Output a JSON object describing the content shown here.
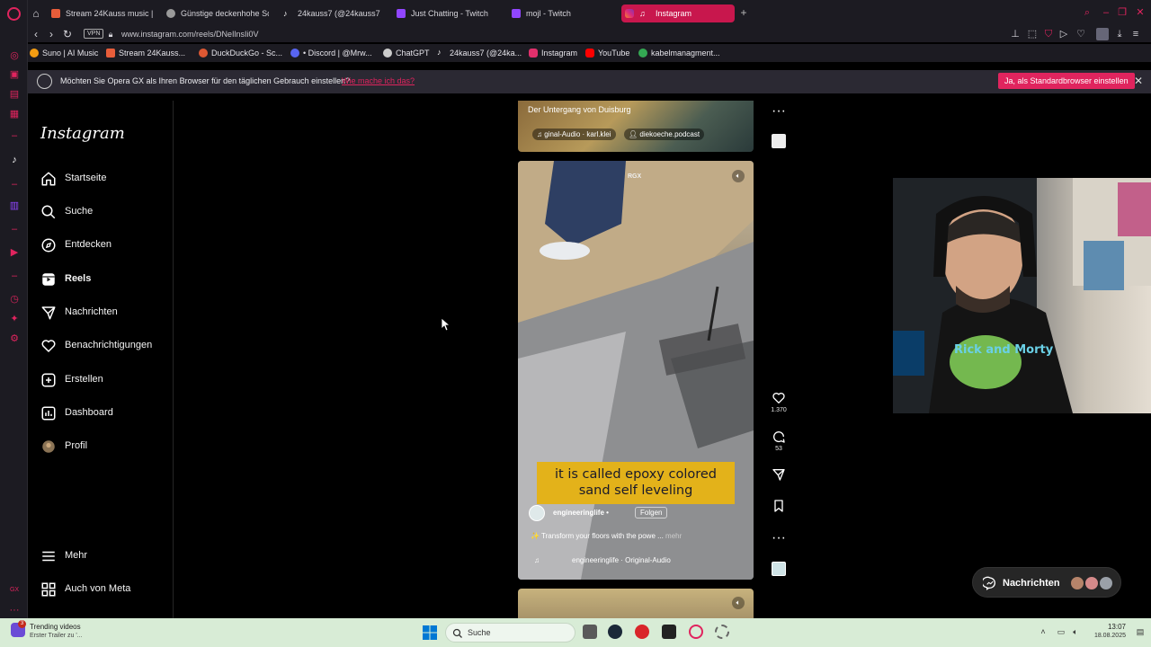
{
  "browser": {
    "tabs": [
      {
        "label": "Stream 24Kauss music | ...",
        "color": "#e85d3a"
      },
      {
        "label": "Günstige deckenhohe Sc...",
        "color": "#9a9a9a"
      },
      {
        "label": "24kauss7 (@24kauss7) |",
        "color": "#ffffff"
      },
      {
        "label": "Just Chatting - Twitch",
        "color": "#9146ff"
      },
      {
        "label": "mojl - Twitch",
        "color": "#9146ff"
      },
      {
        "label": "Instagram",
        "color": "#ffffff"
      }
    ],
    "url": "www.instagram.com/reels/DNeIlnsIi0V",
    "vpn_label": "VPN",
    "bookmarks": [
      {
        "label": "Suno | AI Music",
        "color": "#f39c12"
      },
      {
        "label": "Stream 24Kauss...",
        "color": "#e85d3a"
      },
      {
        "label": "DuckDuckGo - Sc...",
        "color": "#de5833"
      },
      {
        "label": "• Discord | @Mrw...",
        "color": "#5865f2"
      },
      {
        "label": "ChatGPT",
        "color": "#cccccc"
      },
      {
        "label": "24kauss7 (@24ka...",
        "color": "#ffffff"
      },
      {
        "label": "Instagram",
        "color": "#e1306c"
      },
      {
        "label": "YouTube",
        "color": "#ff0000"
      },
      {
        "label": "kabelmanagment...",
        "color": "#34a853"
      }
    ],
    "infobar": {
      "text": "Möchten Sie Opera GX als Ihren Browser für den täglichen Gebrauch einstellen?",
      "link": "Wie mache ich das?",
      "button": "Ja, als Standardbrowser einstellen",
      "close": "✕"
    },
    "accent": "#e0245e"
  },
  "instagram": {
    "logo": "Instagram",
    "nav": [
      {
        "label": "Startseite",
        "icon": "home-icon"
      },
      {
        "label": "Suche",
        "icon": "search-icon"
      },
      {
        "label": "Entdecken",
        "icon": "compass-icon"
      },
      {
        "label": "Reels",
        "icon": "reels-icon"
      },
      {
        "label": "Nachrichten",
        "icon": "send-icon"
      },
      {
        "label": "Benachrichtigungen",
        "icon": "heart-icon"
      },
      {
        "label": "Erstellen",
        "icon": "plus-square-icon"
      },
      {
        "label": "Dashboard",
        "icon": "chart-icon"
      },
      {
        "label": "Profil",
        "icon": "avatar-icon"
      }
    ],
    "more": "Mehr",
    "meta": "Auch von Meta",
    "prev_reel": {
      "title": "Der Untergang von Duisburg",
      "audio": "ginal-Audio · karl.klei",
      "collab": "diekoeche.podcast"
    },
    "reel": {
      "watermark": "RGX",
      "caption_line1": "it is called epoxy colored",
      "caption_line2": "sand self leveling",
      "username": "engineeringlife",
      "dot": "•",
      "follow": "Folgen",
      "description": "✨ Transform your floors with the powe ...",
      "more": "mehr",
      "audio": "engineeringlife · Original-Audio",
      "likes": "1.370",
      "comments": "53"
    },
    "messages_label": "Nachrichten"
  },
  "taskbar": {
    "news_title": "Trending videos",
    "news_sub": "Erster Trailer zu '...",
    "badge": "3",
    "search_placeholder": "Suche",
    "time": "13:07",
    "date": "18.08.2025"
  }
}
